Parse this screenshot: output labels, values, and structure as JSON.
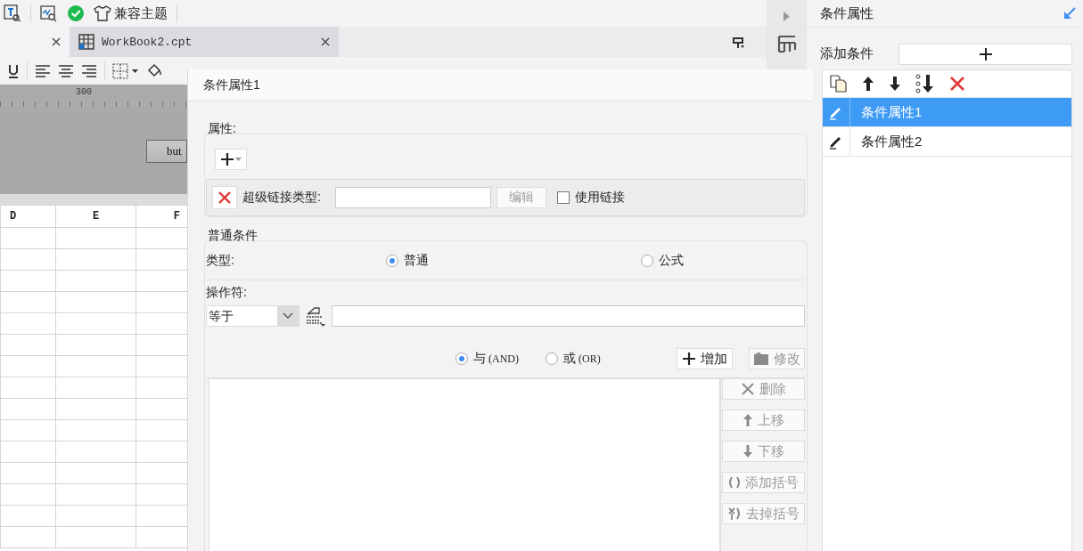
{
  "toolbar": {
    "theme_label": "兼容主题"
  },
  "tabs": [
    {
      "selected": true
    },
    {
      "label": "WorkBook2.cpt",
      "selected": false
    }
  ],
  "ruler": {
    "mark": "300"
  },
  "canvas": {
    "button": "but"
  },
  "sheet": {
    "columns": [
      "D",
      "E",
      "F"
    ]
  },
  "dialog": {
    "title": "条件属性1",
    "attributes": {
      "legend": "属性:",
      "hyperlink_label": "超级链接类型:",
      "edit_button": {
        "label": "编辑",
        "disabled": true
      },
      "use_link": {
        "label": "使用链接",
        "checked": false
      }
    },
    "condition": {
      "legend": "普通条件",
      "type_label": "类型:",
      "types": [
        {
          "label": "普通",
          "selected": true
        },
        {
          "label": "公式",
          "selected": false
        }
      ],
      "operator_label": "操作符:",
      "operator": "等于",
      "logic": [
        {
          "label": "与",
          "note": "(AND)",
          "selected": true
        },
        {
          "label": "或",
          "note": "(OR)",
          "selected": false
        }
      ],
      "actions": [
        {
          "kind": "add",
          "label": "增加",
          "disabled": false
        },
        {
          "kind": "modify",
          "label": "修改",
          "disabled": true
        }
      ],
      "side_buttons": [
        {
          "kind": "delete",
          "label": "删除",
          "disabled": true
        },
        {
          "kind": "up",
          "label": "上移",
          "disabled": true
        },
        {
          "kind": "down",
          "label": "下移",
          "disabled": true
        },
        {
          "kind": "add-bracket",
          "label": "添加括号",
          "disabled": true
        },
        {
          "kind": "remove-bracket",
          "label": "去掉括号",
          "disabled": true
        }
      ]
    }
  },
  "panel": {
    "title": "条件属性",
    "add_label": "添加条件",
    "items": [
      {
        "label": "条件属性1",
        "selected": true
      },
      {
        "label": "条件属性2",
        "selected": false
      }
    ]
  }
}
